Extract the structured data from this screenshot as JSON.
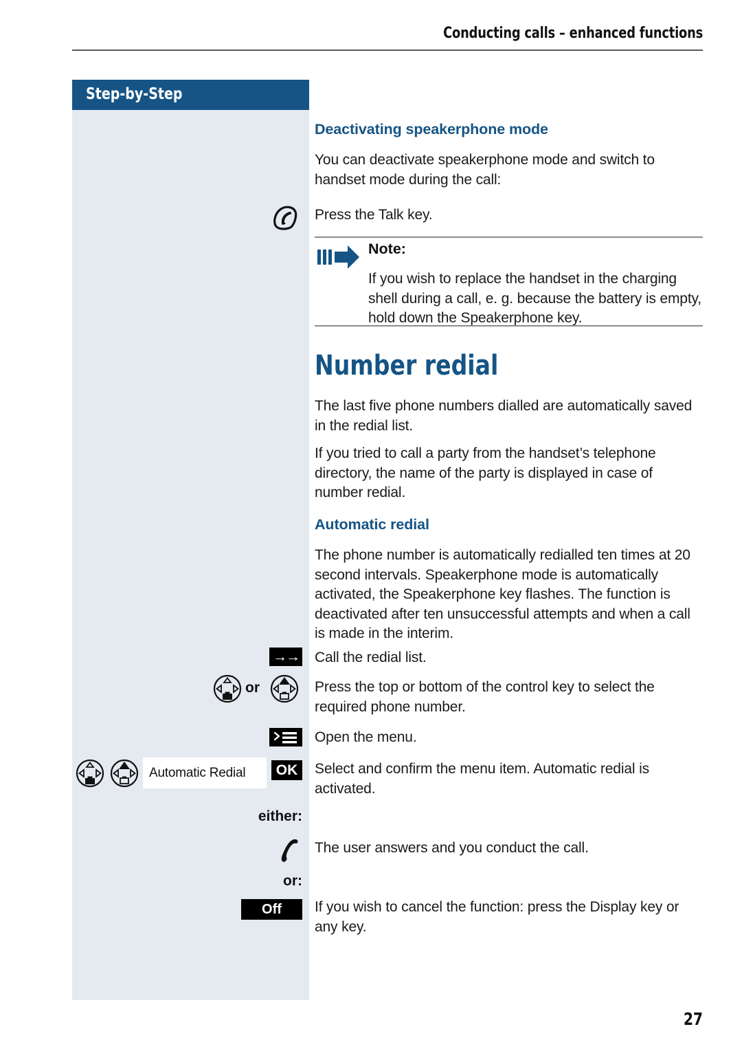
{
  "header": {
    "running_title": "Conducting calls – enhanced functions"
  },
  "sidebar": {
    "banner_label": "Step-by-Step"
  },
  "page_number": "27",
  "colors": {
    "brand_blue": "#155485",
    "sidebar_bg": "#e5eaf0",
    "rule_grey": "#8c8c8c",
    "key_black": "#000000"
  },
  "sections": {
    "deactivating": {
      "heading": "Deactivating speakerphone mode",
      "intro": "You can deactivate speakerphone mode and switch to handset mode during the call:",
      "talk_step": "Press the Talk key.",
      "talk_icon_name": "talk-key-icon"
    },
    "note": {
      "label": "Note:",
      "body": "If you wish to replace the handset in the charging shell during a call, e. g. because the battery is empty, hold down the Speakerphone key.",
      "icon_name": "note-arrow-icon"
    },
    "number_redial": {
      "title": "Number redial",
      "para1": "The last five phone numbers dialled are automatically saved in the redial list.",
      "para2": "If you tried to call a party from the handset’s telephone directory, the name of the party is displayed in case of number redial."
    },
    "automatic_redial": {
      "heading": "Automatic redial",
      "para1": "The phone number is automatically redialled ten times at 20 second intervals. Speakerphone mode is automatically activated, the Speakerphone key flashes. The function is deactivated after ten unsuccessful attempts and when a call is made in the interim."
    }
  },
  "steps": [
    {
      "id": "call-redial-list",
      "icon": "redial-list-key",
      "key_label": "→→",
      "text": "Call the redial list."
    },
    {
      "id": "select-number",
      "icon": "control-key-pair",
      "connector": "or",
      "text": "Press the top or bottom of the control key to select the required phone number."
    },
    {
      "id": "open-menu",
      "icon": "menu-key",
      "text": "Open the menu."
    },
    {
      "id": "confirm-menu-item",
      "icon": "control-key-pair-with-display",
      "display_text": "Automatic Redial",
      "ok_label": "OK",
      "text": "Select and confirm the menu item. Automatic redial is activated."
    }
  ],
  "outcomes": {
    "either_label": "either:",
    "answered": {
      "icon": "handset-icon",
      "text": "The user answers and you conduct the call."
    },
    "or_label": "or:",
    "cancel": {
      "key_label": "Off",
      "text": "If you wish to cancel the function: press the Display key or any key."
    }
  }
}
